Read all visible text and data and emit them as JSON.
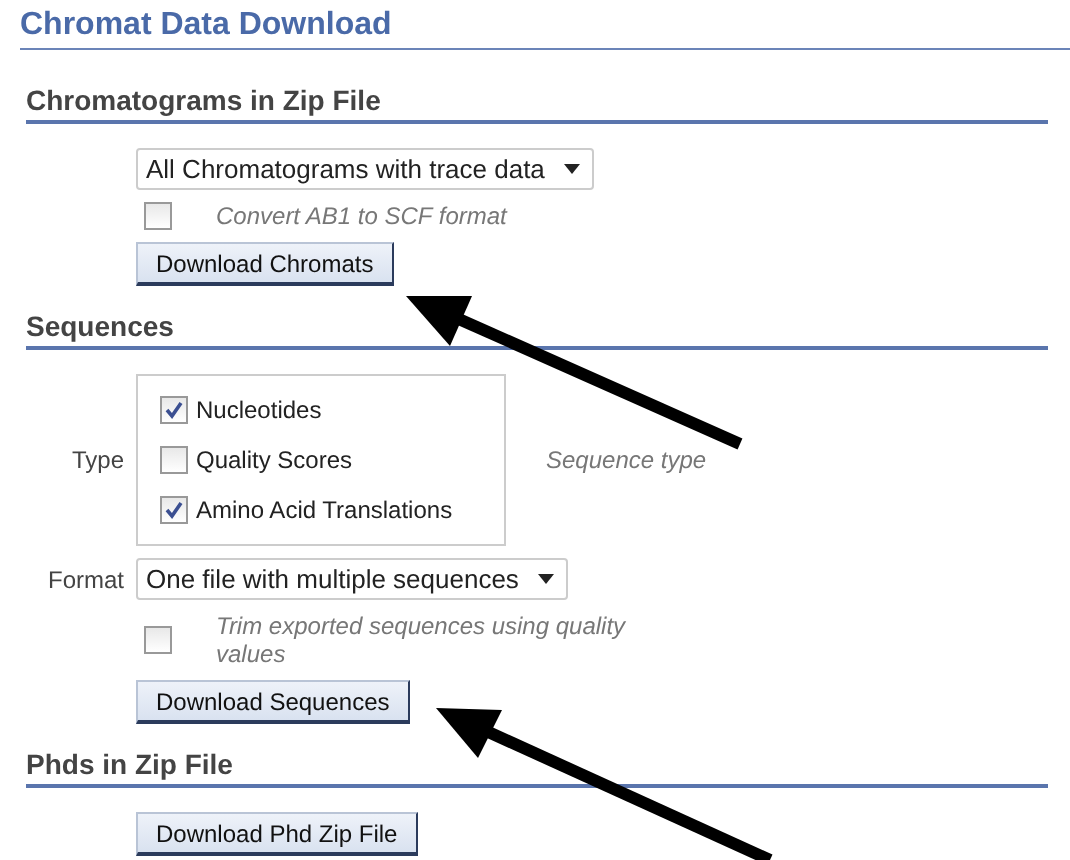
{
  "title": "Chromat Data Download",
  "sections": [
    {
      "heading": "Chromatograms in Zip File",
      "rows": [
        {
          "kind": "select",
          "value": "All Chromatograms with trace data"
        },
        {
          "kind": "checkbox",
          "checked": false,
          "label": "Convert AB1 to SCF format"
        },
        {
          "kind": "button",
          "label": "Download Chromats"
        }
      ]
    },
    {
      "heading": "Sequences",
      "rows": [
        {
          "kind": "checkgroup",
          "label": "Type",
          "hint": "Sequence type",
          "options": [
            {
              "label": "Nucleotides",
              "checked": true
            },
            {
              "label": "Quality Scores",
              "checked": false
            },
            {
              "label": "Amino Acid Translations",
              "checked": true
            }
          ]
        },
        {
          "kind": "select",
          "label": "Format",
          "value": "One file with multiple sequences"
        },
        {
          "kind": "checkbox",
          "checked": false,
          "label": "Trim exported sequences using quality values"
        },
        {
          "kind": "button",
          "label": "Download Sequences"
        }
      ]
    },
    {
      "heading": "Phds in Zip File",
      "rows": [
        {
          "kind": "button",
          "label": "Download Phd Zip File"
        }
      ]
    }
  ]
}
